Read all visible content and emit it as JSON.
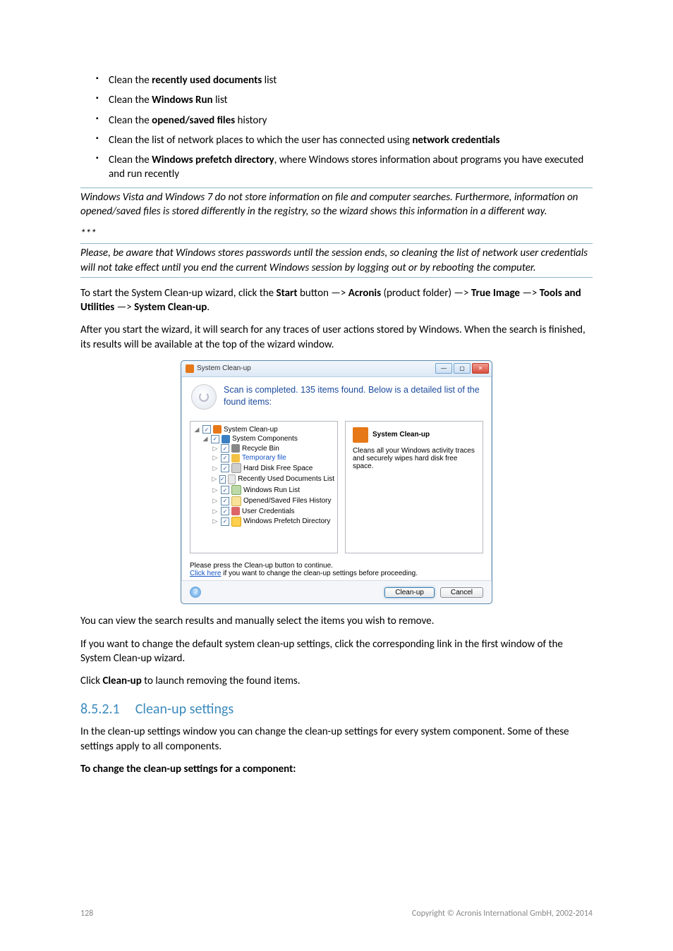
{
  "bullets": [
    {
      "pre": "Clean the ",
      "bold": "recently used documents",
      "post": " list"
    },
    {
      "pre": "Clean the ",
      "bold": "Windows Run",
      "post": " list"
    },
    {
      "pre": "Clean the ",
      "bold": "opened/saved files",
      "post": " history"
    },
    {
      "pre": "Clean the list of network places to which the user has connected using ",
      "bold": "network credentials",
      "post": ""
    },
    {
      "pre": "Clean the ",
      "bold": "Windows prefetch directory",
      "post": ", where Windows stores information about programs you have executed and run recently"
    }
  ],
  "note1": "Windows Vista and Windows 7 do not store information on file and computer searches. Furthermore, information on opened/saved files is stored differently in the registry, so the wizard shows this information in a different way.",
  "asterisks": "***",
  "note2": "Please, be aware that Windows stores passwords until the session ends, so cleaning the list of network user credentials will not take effect until you end the current Windows session by logging out or by rebooting the computer.",
  "start_line": {
    "p1": "To start the System Clean-up wizard, click the ",
    "b1": "Start",
    "p2": " button —> ",
    "b2": "Acronis",
    "p3": " (product folder) —> ",
    "b3": "True Image",
    "p4": " —> ",
    "b4": "Tools and Utilities",
    "p5": " —> ",
    "b5": "System Clean-up",
    "p6": "."
  },
  "after_start": "After you start the wizard, it will search for any traces of user actions stored by Windows. When the search is finished, its results will be available at the top of the wizard window.",
  "dialog": {
    "title": "System Clean-up",
    "header": "Scan is completed. 135 items found. Below is a detailed list of the found items:",
    "tree": {
      "root": "System Clean-up",
      "comp": "System Components",
      "items": [
        "Recycle Bin",
        "Temporary file",
        "Hard Disk Free Space",
        "Recently Used Documents List",
        "Windows Run List",
        "Opened/Saved Files History",
        "User Credentials",
        "Windows Prefetch Directory"
      ]
    },
    "desc": {
      "title": "System Clean-up",
      "body": "Cleans all your Windows activity traces and securely wipes hard disk free space."
    },
    "footer1": "Please press the Clean-up button to continue.",
    "footer2a": "Click here",
    "footer2b": " if you want to change the clean-up settings before proceeding.",
    "btn_cleanup": "Clean-up",
    "btn_cancel": "Cancel"
  },
  "after_dialog1": "You can view the search results and manually select the items you wish to remove.",
  "after_dialog2": "If you want to change the default system clean-up settings, click the corresponding link in the first window of the System Clean-up wizard.",
  "after_dialog3_pre": "Click ",
  "after_dialog3_bold": "Clean-up",
  "after_dialog3_post": " to launch removing the found items.",
  "section": {
    "num": "8.5.2.1",
    "title": "Clean-up settings"
  },
  "section_p1": "In the clean-up settings window you can change the clean-up settings for every system component. Some of these settings apply to all components.",
  "section_p2": "To change the clean-up settings for a component:",
  "footer": {
    "page": "128",
    "copyright": "Copyright © Acronis International GmbH, 2002-2014"
  }
}
